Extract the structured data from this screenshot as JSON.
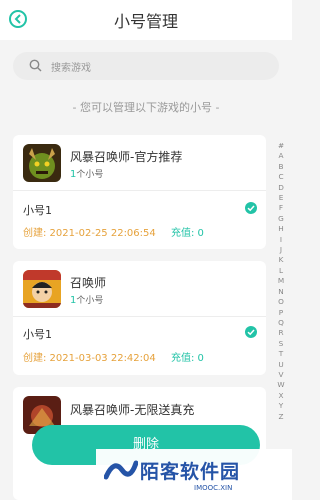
{
  "header": {
    "title": "小号管理"
  },
  "search": {
    "placeholder": "搜索游戏"
  },
  "hint": "- 您可以管理以下游戏的小号 -",
  "games": [
    {
      "name": "风暴召唤师-官方推荐",
      "count": "1",
      "count_unit": "个小号",
      "account": {
        "name": "小号1",
        "created": "创建: 2021-02-25 22:06:54",
        "recharge": "充值: 0",
        "checked": true
      }
    },
    {
      "name": "召唤师",
      "count": "1",
      "count_unit": "个小号",
      "account": {
        "name": "小号1",
        "created": "创建: 2021-03-03 22:42:04",
        "recharge": "充值: 0",
        "checked": true
      }
    },
    {
      "name": "风暴召唤师-无限送真充"
    }
  ],
  "alpha_index": "#ABCDEFGHIJKLMNOPQRSTUVWXYZ",
  "actions": {
    "delete_label": "删除"
  },
  "watermark": {
    "text": "陌客软件园",
    "sub": "IMOOC.XIN"
  },
  "colors": {
    "accent": "#22c3a7",
    "created_text": "#e6a23c",
    "background": "#f4f4f4"
  }
}
